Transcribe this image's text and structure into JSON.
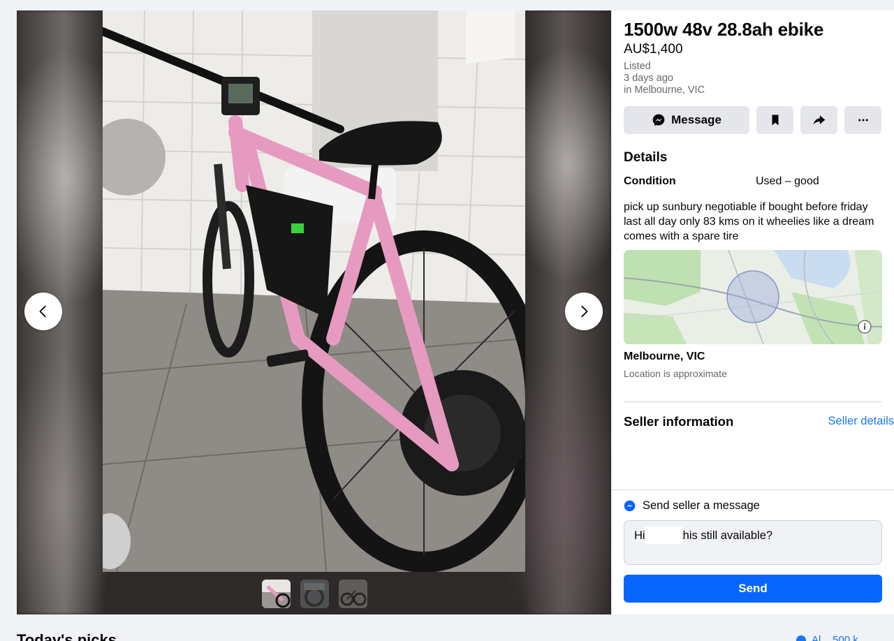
{
  "listing": {
    "title": "1500w 48v 28.8ah ebike",
    "price": "AU$1,400",
    "listed_label": "Listed",
    "listed_time": "3 days ago",
    "listed_location": "in Melbourne, VIC"
  },
  "actions": {
    "message_label": "Message",
    "save_icon": "bookmark-icon",
    "share_icon": "share-icon",
    "more_icon": "more-icon"
  },
  "details": {
    "heading": "Details",
    "condition_label": "Condition",
    "condition_value": "Used – good",
    "description": "pick up sunbury negotiable if bought before friday last all day only 83 kms on it wheelies like a dream   comes with a spare tire"
  },
  "location": {
    "city": "Melbourne, VIC",
    "note": "Location is approximate"
  },
  "seller": {
    "heading": "Seller information",
    "link": "Seller details"
  },
  "compose": {
    "heading": "Send seller a message",
    "message_value": "Hi        s this still available?",
    "send_label": "Send"
  },
  "feed": {
    "heading": "Today's picks",
    "location_text": "Al... 500 k"
  },
  "colors": {
    "accent": "#0866ff",
    "link": "#1877f2",
    "button_bg": "#e4e6eb",
    "bike_frame": "#e79ac0"
  }
}
